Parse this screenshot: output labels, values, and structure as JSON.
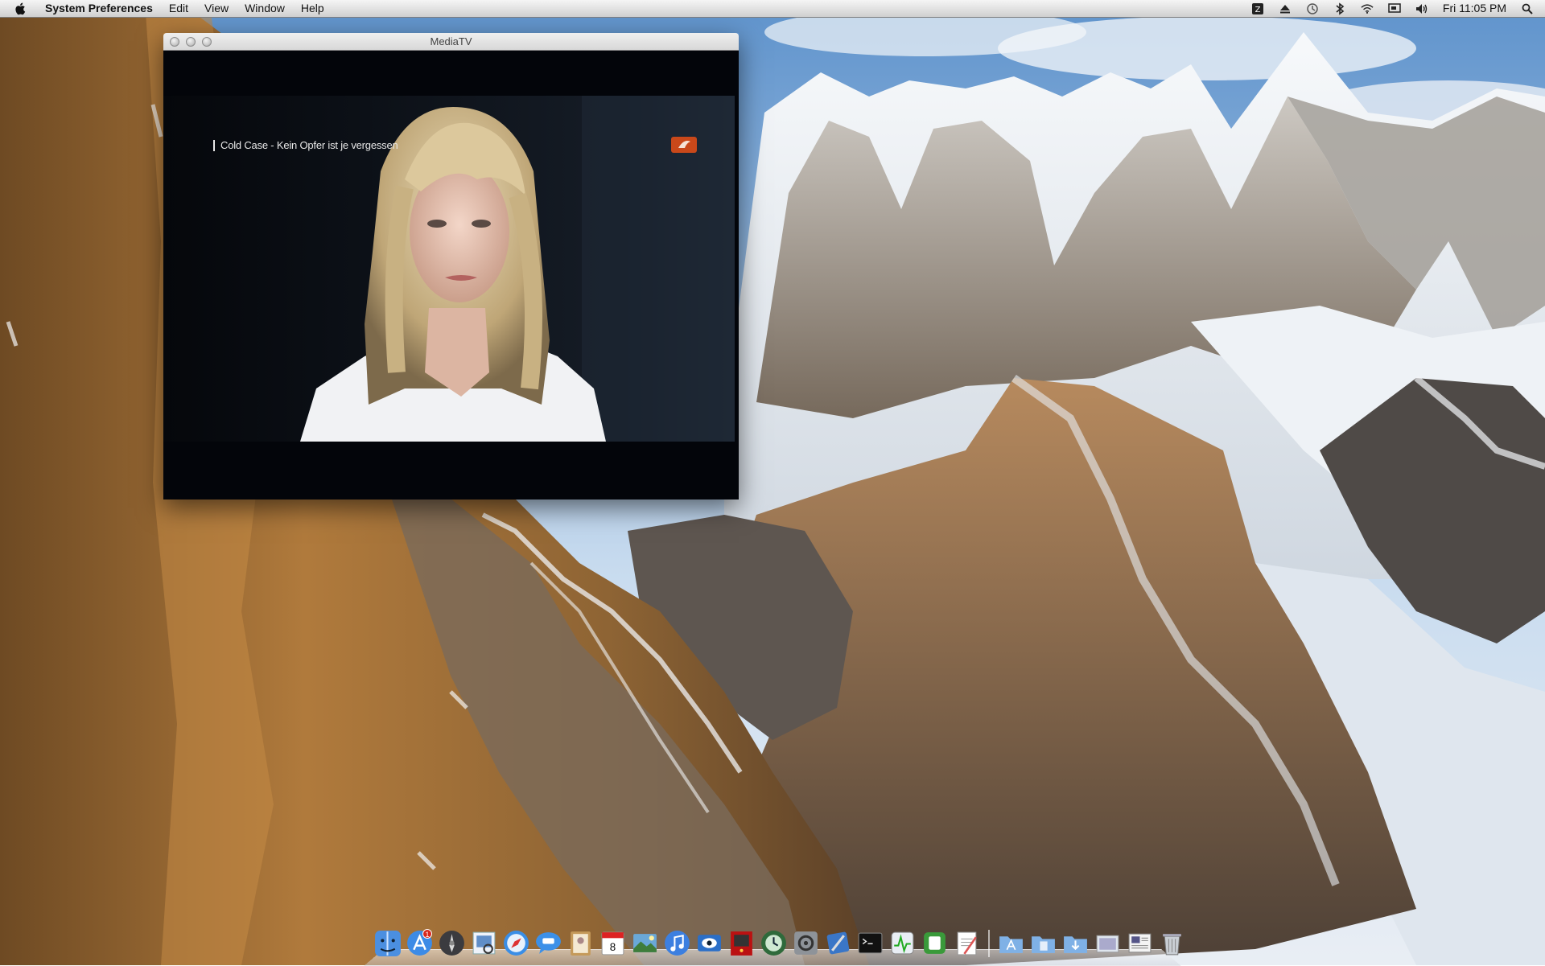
{
  "menubar": {
    "apple_icon": "apple-icon",
    "app_name": "System Preferences",
    "menus": [
      "Edit",
      "View",
      "Window",
      "Help"
    ],
    "status_icons": [
      "input-source-icon",
      "eject-icon",
      "time-machine-icon",
      "bluetooth-icon",
      "wifi-icon",
      "display-icon",
      "volume-icon"
    ],
    "clock": "Fri 11:05 PM",
    "spotlight_icon": "spotlight-icon"
  },
  "window": {
    "title": "MediaTV",
    "video": {
      "program_title": "Cold Case - Kein Opfer ist je vergessen",
      "channel_logo": "channel-logo-icon"
    }
  },
  "dock": {
    "apps": [
      {
        "name": "finder-icon"
      },
      {
        "name": "app-store-icon",
        "badge": "1"
      },
      {
        "name": "launchpad-icon"
      },
      {
        "name": "preview-icon"
      },
      {
        "name": "safari-icon"
      },
      {
        "name": "ichat-icon"
      },
      {
        "name": "address-book-icon"
      },
      {
        "name": "ical-icon",
        "label": "8"
      },
      {
        "name": "iphoto-icon"
      },
      {
        "name": "itunes-icon"
      },
      {
        "name": "eyetv-icon"
      },
      {
        "name": "photo-booth-icon"
      },
      {
        "name": "time-machine-icon"
      },
      {
        "name": "system-preferences-icon"
      },
      {
        "name": "xcode-icon"
      },
      {
        "name": "terminal-icon"
      },
      {
        "name": "activity-monitor-icon"
      },
      {
        "name": "sidebar-utility-icon"
      },
      {
        "name": "textedit-icon"
      }
    ],
    "stacks": [
      "applications-folder-icon",
      "documents-folder-icon",
      "downloads-folder-icon",
      "screenshots-stack-icon",
      "files-stack-icon",
      "trash-icon"
    ]
  },
  "colors": {
    "menubar_bg": "#e1e1e1",
    "video_bg": "#03050a",
    "badge_red": "#d8261c"
  }
}
